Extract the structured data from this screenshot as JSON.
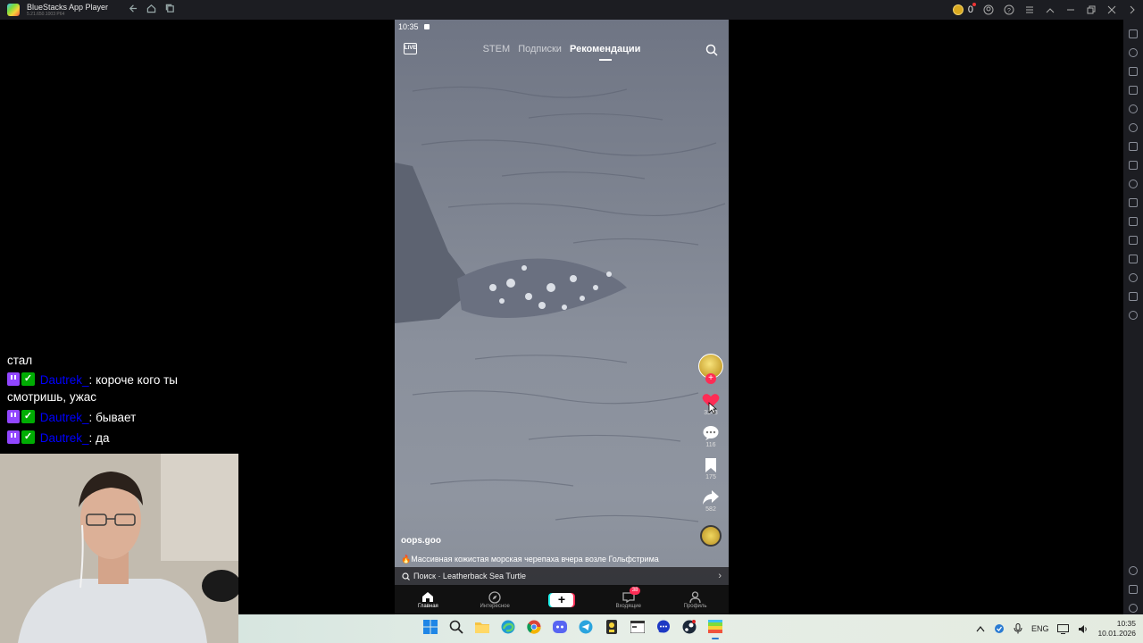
{
  "bluestacks": {
    "title": "BlueStacks App Player",
    "version": "5.21.650.1003 P64",
    "coins": "0",
    "nav_icons": [
      "back-icon",
      "home-icon",
      "multi-instance-icon"
    ],
    "window_icons": [
      "account-icon",
      "help-icon",
      "menu-icon",
      "collapse-icon",
      "minimize-icon",
      "restore-icon",
      "close-icon",
      "sidebar-toggle-icon"
    ]
  },
  "tiktok": {
    "status_time": "10:35",
    "tabs": [
      "STEM",
      "Подписки",
      "Рекомендации"
    ],
    "active_tab": "Рекомендации",
    "live_label": "LIVE",
    "likes": "3243",
    "comments": "116",
    "saves": "175",
    "shares": "582",
    "username": "oops.goo",
    "description": "🔥Массивная кожистая морская черепаха вчера возле Гольфстрима",
    "search_suggestion": "Поиск · Leatherback Sea Turtle",
    "bottom_nav": [
      {
        "label": "Главная",
        "icon": "home-icon",
        "active": true
      },
      {
        "label": "Интересное",
        "icon": "compass-icon",
        "active": false
      },
      {
        "label": "",
        "icon": "plus-icon",
        "active": false
      },
      {
        "label": "Входящие",
        "icon": "inbox-icon",
        "active": false,
        "badge": "38"
      },
      {
        "label": "Профиль",
        "icon": "profile-icon",
        "active": false
      }
    ],
    "colors": {
      "accent": "#fe2c55",
      "cyan": "#25f4ee"
    }
  },
  "chat": {
    "partial_line": "стал",
    "messages": [
      {
        "user": "Dautrek_",
        "text": "короче кого ты смотришь, ужас"
      },
      {
        "user": "Dautrek_",
        "text": "бывает"
      },
      {
        "user": "Dautrek_",
        "text": "да"
      }
    ],
    "colors": {
      "username": "#0000ff",
      "twitch": "#9146ff",
      "vip": "#00ad03"
    }
  },
  "taskbar": {
    "apps": [
      "windows-start-icon",
      "search-icon",
      "file-explorer-icon",
      "edge-icon",
      "chrome-icon",
      "discord-icon",
      "telegram-icon",
      "obs-icon",
      "terminal-icon",
      "messenger-icon",
      "steam-icon",
      "bluestacks-icon"
    ],
    "language": "ENG",
    "time": "10:35",
    "date": "10.01.2026"
  }
}
